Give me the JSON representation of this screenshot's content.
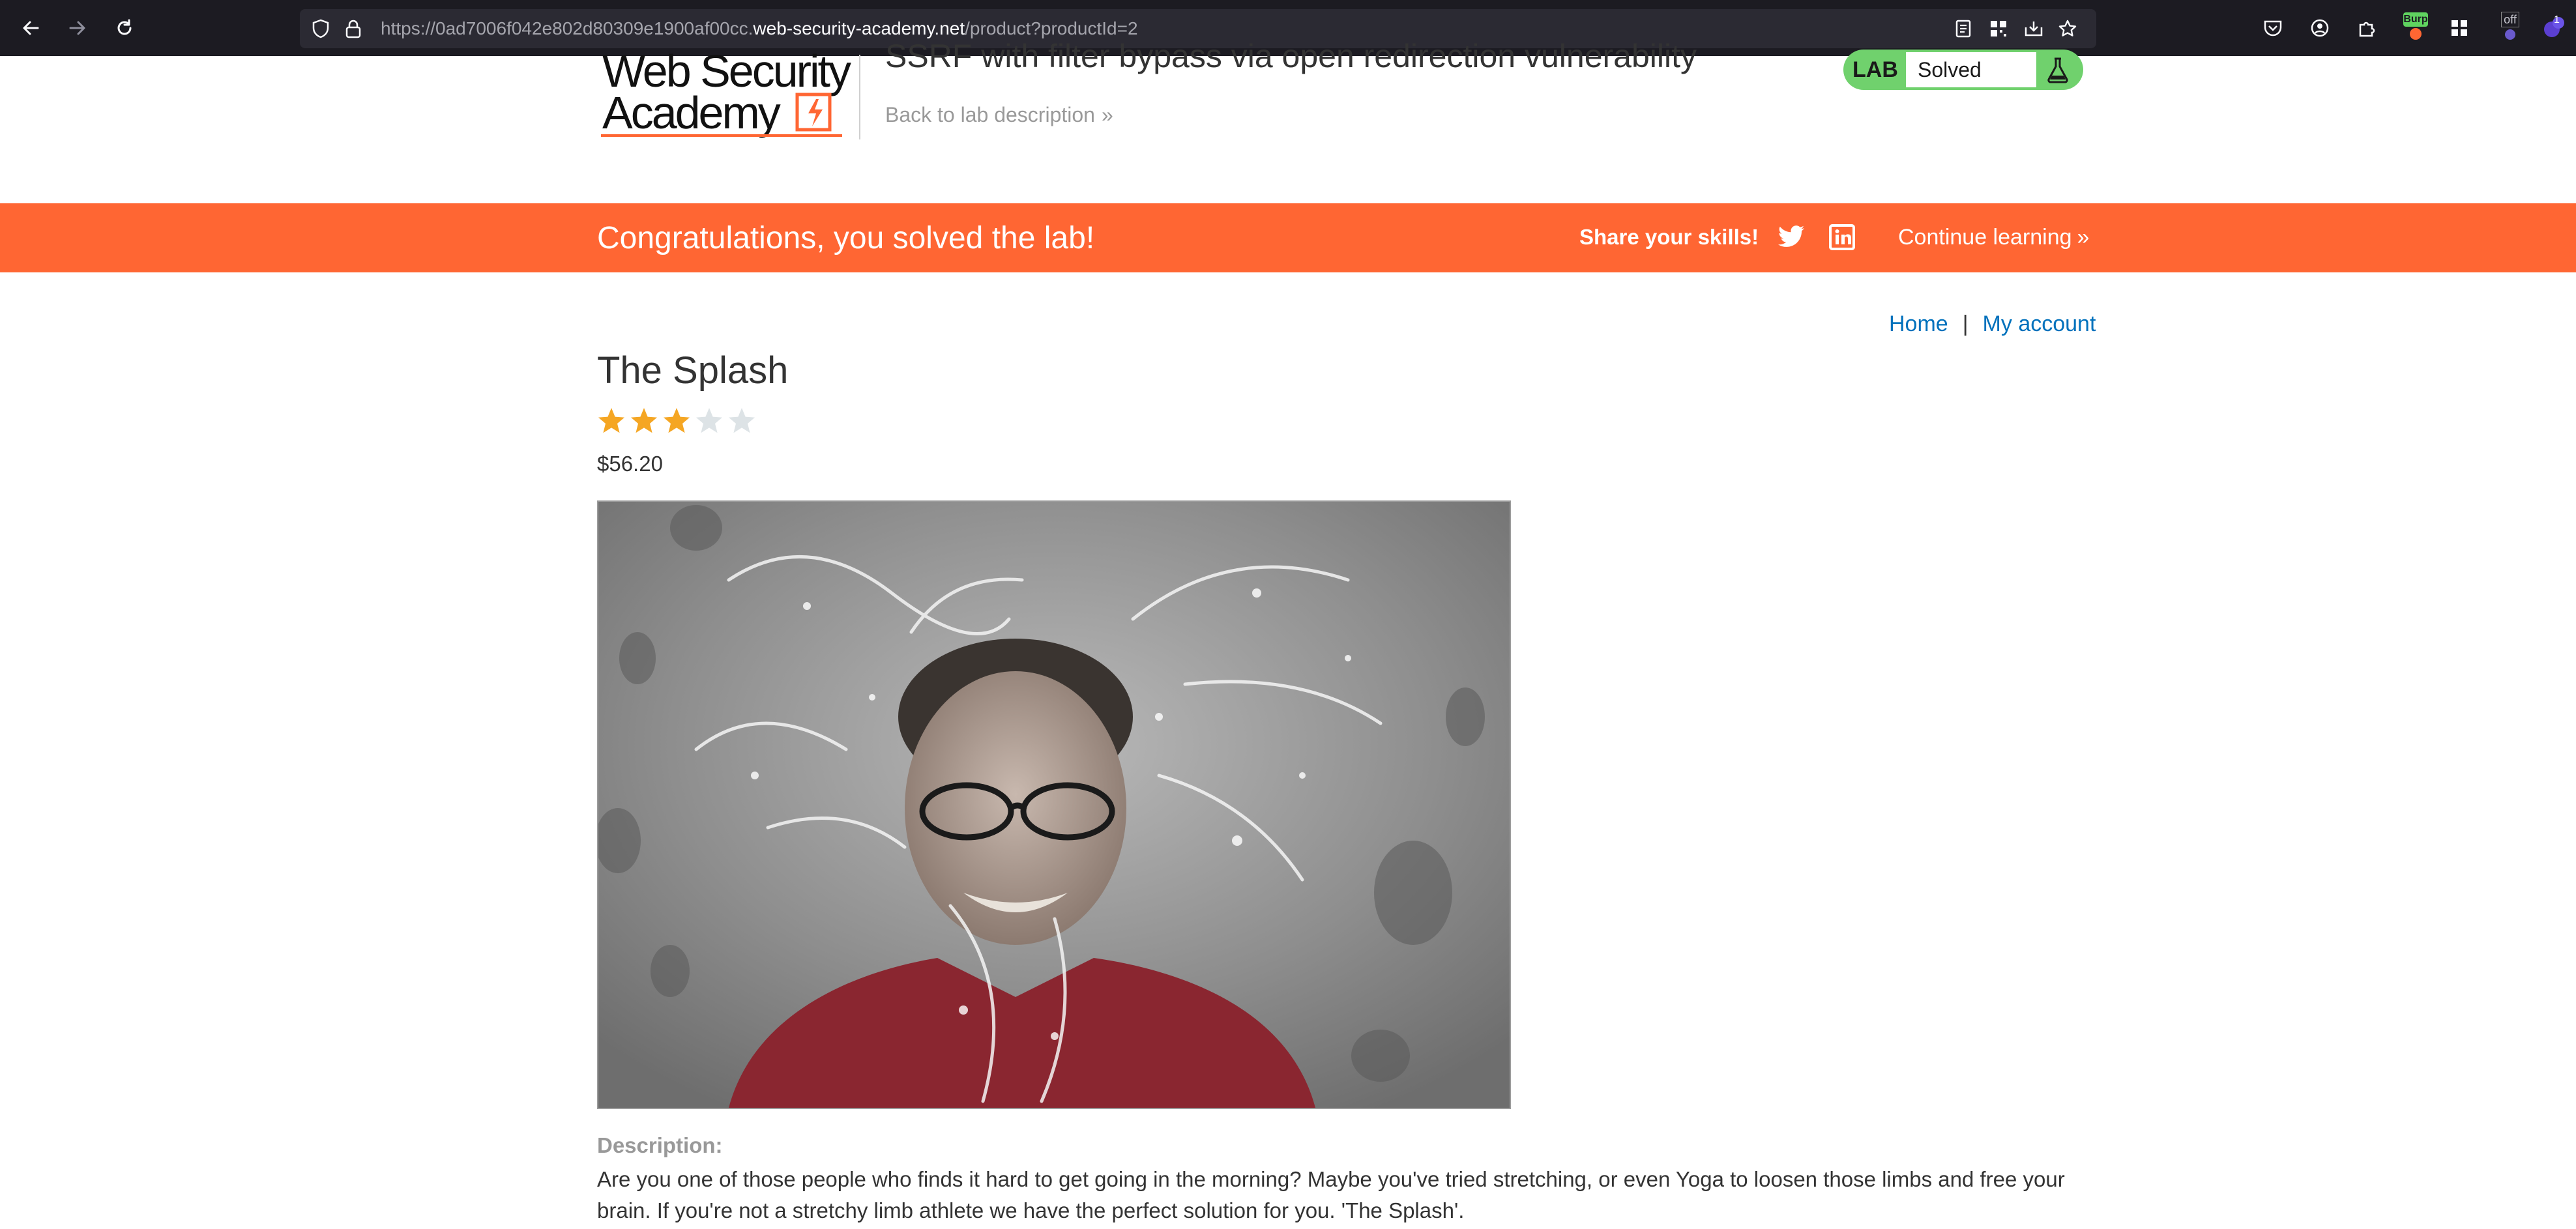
{
  "browser": {
    "url_prefix": "https://0ad7006f042e802d80309e1900af00cc.",
    "url_host": "web-security-academy.net",
    "url_path": "/product?productId=2",
    "burp_label": "Burp",
    "off_label": "off",
    "badge_count": "1"
  },
  "lab_header": {
    "logo_line1": "Web Security",
    "logo_line2": "Academy",
    "title": "SSRF with filter bypass via open redirection vulnerability",
    "back_link": "Back to lab description",
    "back_chevron": "»",
    "status_tag": "LAB",
    "status_value": "Solved"
  },
  "banner": {
    "message": "Congratulations, you solved the lab!",
    "share": "Share your skills!",
    "continue": "Continue learning",
    "continue_chevron": "»"
  },
  "top_links": {
    "home": "Home",
    "separator": "|",
    "account": "My account"
  },
  "product": {
    "name": "The Splash",
    "rating": 3,
    "rating_max": 5,
    "price": "$56.20",
    "description_label": "Description:",
    "description": "Are you one of those people who finds it hard to get going in the morning? Maybe you've tried stretching, or even Yoga to loosen those limbs and free your brain. If you're not a stretchy limb athlete we have the perfect solution for you. 'The Splash'."
  },
  "colors": {
    "accent": "#ff6633",
    "lab_green": "#70d16d",
    "link_blue": "#0071bc",
    "star_on": "#f5a623",
    "star_off": "#dde3e6"
  }
}
